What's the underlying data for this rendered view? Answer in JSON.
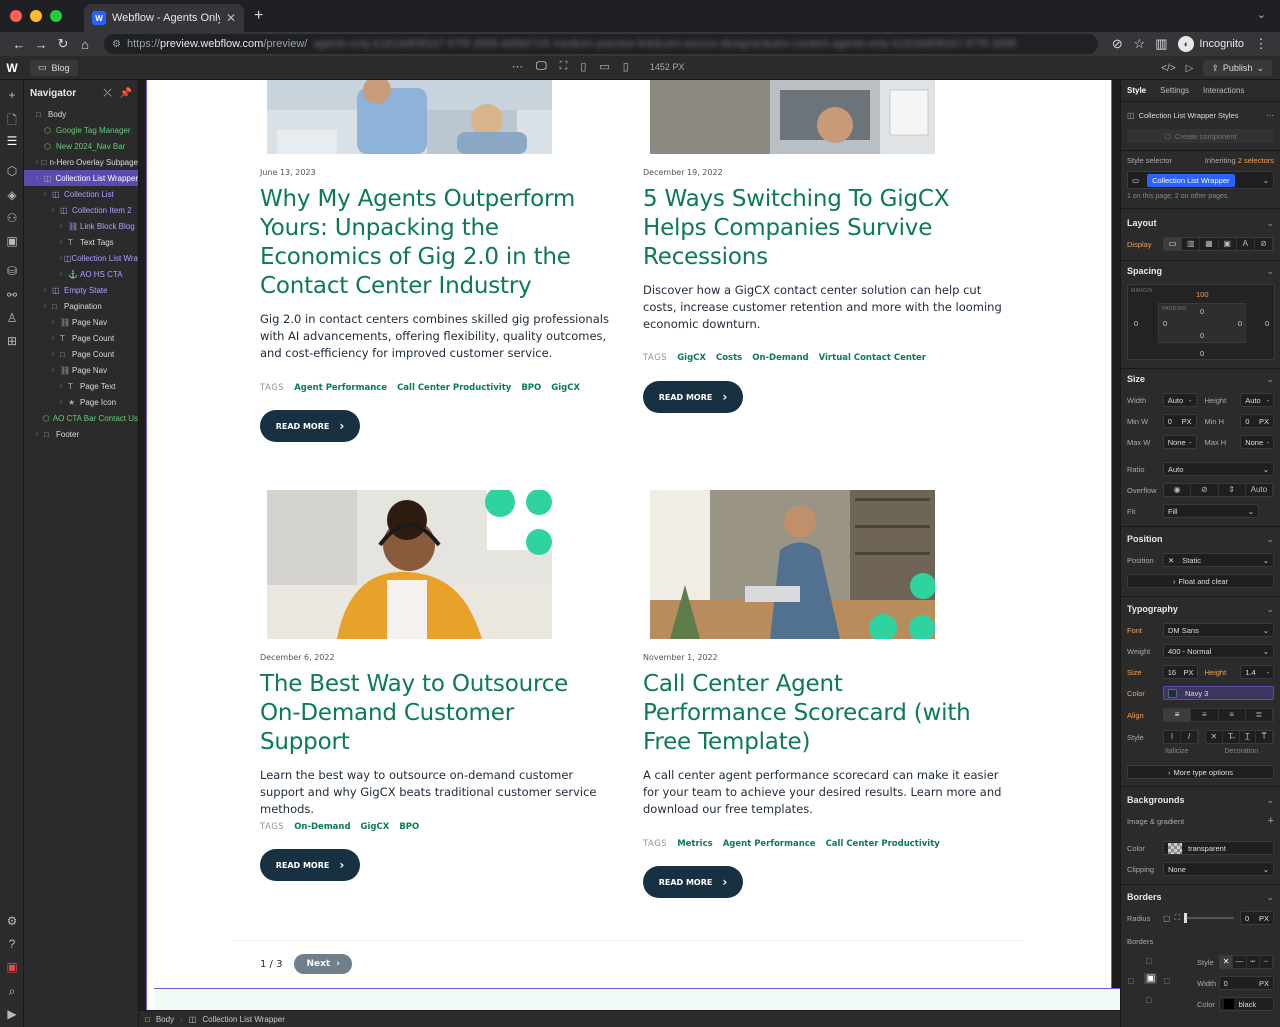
{
  "browser": {
    "tab_title": "Webflow - Agents Only Websit",
    "url_scheme": "https://",
    "url_host": "preview.webflow.com",
    "url_path": "/preview/",
    "url_blurred": "agents-only-b1818d69f167-875f-3988-dd5b57cfr-medium-preview-link&utm-source-designer&utm-content-agents-only-b1818d69f167-875f-3988",
    "incognito_label": "Incognito"
  },
  "designer": {
    "page_name": "Blog",
    "breakpoint_px": "1452 PX",
    "publish_label": "Publish"
  },
  "navigator": {
    "title": "Navigator",
    "items": [
      {
        "label": "Body",
        "depth": 0,
        "style": "normal",
        "icon": "□"
      },
      {
        "label": "Google Tag Manager",
        "depth": 1,
        "style": "green",
        "icon": "⬡"
      },
      {
        "label": "New 2024_Nav Bar",
        "depth": 1,
        "style": "green",
        "icon": "⬡"
      },
      {
        "label": "n-Hero Overlay Subpage",
        "depth": 1,
        "style": "normal",
        "icon": "□"
      },
      {
        "label": "Collection List Wrapper",
        "depth": 1,
        "style": "sel",
        "icon": "◫"
      },
      {
        "label": "Collection List",
        "depth": 2,
        "style": "purple",
        "icon": "◫"
      },
      {
        "label": "Collection Item 2",
        "depth": 3,
        "style": "purple",
        "icon": "◫"
      },
      {
        "label": "Link Block Blog",
        "depth": 4,
        "style": "purple",
        "icon": "⛓"
      },
      {
        "label": "Text Tags",
        "depth": 4,
        "style": "normal",
        "icon": "T"
      },
      {
        "label": "Collection List Wra",
        "depth": 4,
        "style": "purple",
        "icon": "◫"
      },
      {
        "label": "AO HS CTA",
        "depth": 4,
        "style": "purple",
        "icon": "⚓"
      },
      {
        "label": "Empty State",
        "depth": 2,
        "style": "purple",
        "icon": "◫"
      },
      {
        "label": "Pagination",
        "depth": 2,
        "style": "normal",
        "icon": "□"
      },
      {
        "label": "Page Nav",
        "depth": 3,
        "style": "normal",
        "icon": "⛓"
      },
      {
        "label": "Page Count",
        "depth": 3,
        "style": "normal",
        "icon": "T"
      },
      {
        "label": "Page Count",
        "depth": 3,
        "style": "normal",
        "icon": "□"
      },
      {
        "label": "Page Nav",
        "depth": 3,
        "style": "normal",
        "icon": "⛓"
      },
      {
        "label": "Page Text",
        "depth": 4,
        "style": "normal",
        "icon": "T"
      },
      {
        "label": "Page Icon",
        "depth": 4,
        "style": "normal",
        "icon": "★"
      },
      {
        "label": "AO CTA Bar Contact Us",
        "depth": 1,
        "style": "green",
        "icon": "⬡"
      },
      {
        "label": "Footer",
        "depth": 1,
        "style": "normal",
        "icon": "□"
      }
    ]
  },
  "posts": [
    {
      "date": "June 13, 2023",
      "title": "Why My Agents Outperform Yours: Unpacking the Economics of Gig 2.0 in the Contact Center Industry",
      "desc": "Gig 2.0 in contact centers combines skilled gig professionals with AI advancements, offering flexibility, quality outcomes, and cost-efficiency for improved customer service.",
      "tags": [
        "Agent Performance",
        "Call Center Productivity",
        "BPO",
        "GigCX"
      ]
    },
    {
      "date": "December 19, 2022",
      "title": "5 Ways Switching To GigCX Helps Companies Survive Recessions",
      "desc": "Discover how a GigCX contact center solution can help cut costs, increase customer retention and more with the looming economic downturn.",
      "tags": [
        "GigCX",
        "Costs",
        "On-Demand",
        "Virtual Contact Center"
      ]
    },
    {
      "date": "December 6, 2022",
      "title": "The Best Way to Outsource On-Demand Customer Support",
      "desc": "Learn the best way to outsource on-demand customer support and why GigCX beats traditional customer service methods.",
      "tags": [
        "On-Demand",
        "GigCX",
        "BPO"
      ]
    },
    {
      "date": "November 1, 2022",
      "title": "Call Center Agent Performance Scorecard (with Free Template)",
      "desc": "A call center agent performance scorecard can make it easier for your team to achieve your desired results. Learn more and download our free templates.",
      "tags": [
        "Metrics",
        "Agent Performance",
        "Call Center Productivity"
      ]
    }
  ],
  "blog": {
    "tags_label": "TAGS",
    "read_more": "READ MORE",
    "page_count": "1 / 3",
    "next_label": "Next"
  },
  "breadcrumbs": [
    "Body",
    "Collection List Wrapper"
  ],
  "panel": {
    "tabs": [
      "Style",
      "Settings",
      "Interactions"
    ],
    "styles_title": "Collection List Wrapper Styles",
    "create_component": "Create component",
    "style_selector_label": "Style selector",
    "inheriting_prefix": "Inheriting",
    "inheriting_count": "2 selectors",
    "selector": "Collection List Wrapper",
    "selector_note": "1 on this page, 2 on other pages.",
    "layout_title": "Layout",
    "display_label": "Display",
    "spacing_title": "Spacing",
    "margin_label": "MARGIN",
    "padding_label": "PADDING",
    "margin_top": "100",
    "margin_left": "0",
    "margin_right": "0",
    "margin_bottom": "0",
    "padding_top": "0",
    "padding_left": "0",
    "padding_right": "0",
    "padding_bottom": "0",
    "padding_center": "0",
    "size_title": "Size",
    "width_label": "Width",
    "width_val": "Auto",
    "height_label": "Height",
    "height_val": "Auto",
    "minw_label": "Min W",
    "minw_val": "0",
    "minh_label": "Min H",
    "minh_val": "0",
    "maxw_label": "Max W",
    "maxw_val": "None",
    "maxh_label": "Max H",
    "maxh_val": "None",
    "unit_px": "PX",
    "ratio_label": "Ratio",
    "ratio_val": "Auto",
    "overflow_label": "Overflow",
    "overflow_auto": "Auto",
    "fit_label": "Fit",
    "fit_val": "Fill",
    "position_title": "Position",
    "position_label": "Position",
    "position_val": "Static",
    "float_clear": "Float and clear",
    "typo_title": "Typography",
    "font_label": "Font",
    "font_val": "DM Sans",
    "weight_label": "Weight",
    "weight_val": "400 - Normal",
    "size_label": "Size",
    "size_val": "16",
    "lineh_label": "Height",
    "lineh_val": "1.4",
    "color_label": "Color",
    "color_val": "Navy 3",
    "align_label": "Align",
    "style_label": "Style",
    "italicize": "Italicize",
    "decoration": "Decoration",
    "more_type": "More type options",
    "bg_title": "Backgrounds",
    "image_gradient": "Image & gradient",
    "bg_color_label": "Color",
    "bg_color_val": "transparent",
    "clipping_label": "Clipping",
    "clipping_val": "None",
    "borders_title": "Borders",
    "radius_label": "Radius",
    "radius_val": "0",
    "borders_label": "Borders",
    "bstyle_label": "Style",
    "bwidth_label": "Width",
    "bwidth_val": "0",
    "bcolor_label": "Color",
    "bcolor_val": "black"
  },
  "colors": {
    "accent_green": "#0b7a55",
    "navy": "#173143",
    "webflow_blue": "#2b62ff",
    "selection_purple": "#5b4bb0",
    "orange_label": "#f3a14e"
  }
}
